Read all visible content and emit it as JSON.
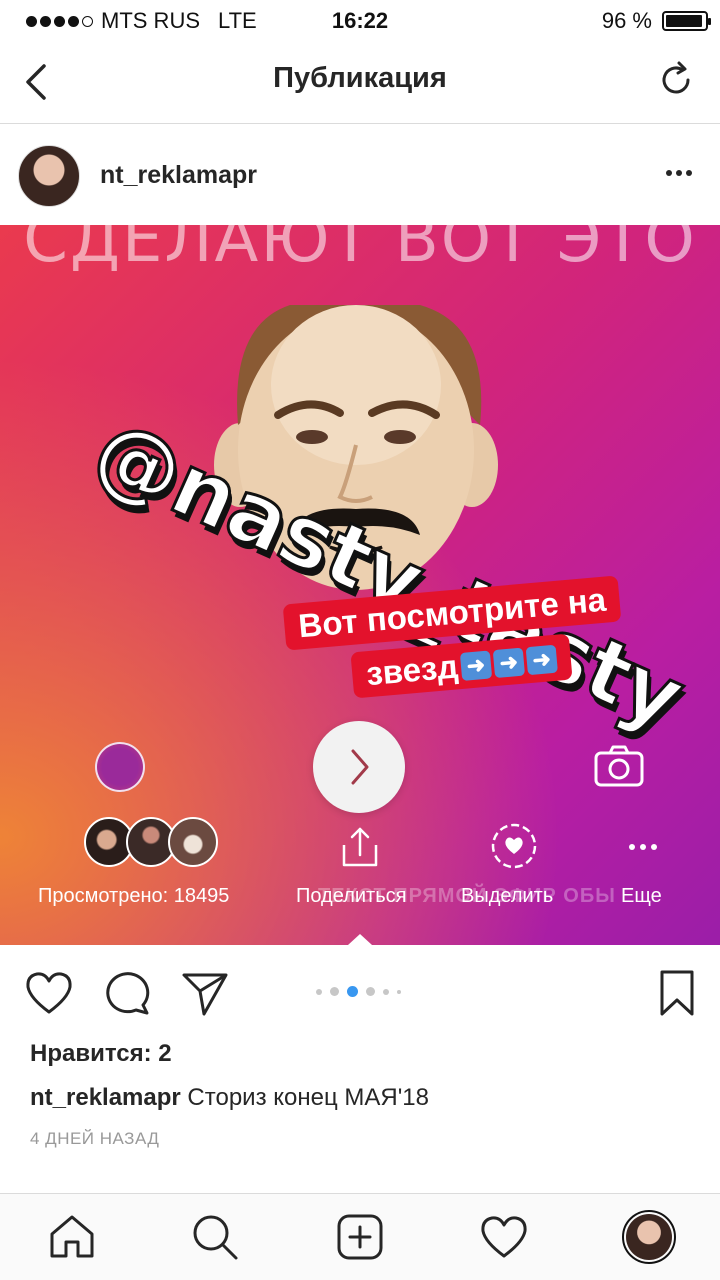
{
  "status_bar": {
    "carrier": "MTS RUS",
    "network": "LTE",
    "time": "16:22",
    "battery": "96 %",
    "battery_level": 0.96
  },
  "header": {
    "title": "Публикация",
    "icons": [
      "back-chevron-icon",
      "refresh-icon"
    ]
  },
  "post": {
    "username": "nt_reklamapr",
    "media": {
      "top_text": "СДЕЛАЮТ ВОТ ЭТО",
      "watermark": "@nasty_tasty",
      "sticker_line1": "Вот посмотрите на",
      "sticker_line2": "звезд",
      "ghost_text": "ТЕКСТ   ПРЯМОЙ ЭФИР   ОБЫ",
      "views_label": "Просмотрено: 18495",
      "share_label": "Поделиться",
      "highlight_label": "Выделить",
      "more_label": "Еще"
    },
    "carousel_index": 3,
    "likes": "Нравится: 2",
    "caption_user": "nt_reklamapr",
    "caption_text": "Сториз конец МАЯ'18",
    "date": "4 ДНЕЙ НАЗАД"
  },
  "colors": {
    "accent": "#3897f0",
    "sticker": "#e3122c",
    "divider": "#dbdbdb"
  },
  "tab_bar": {
    "icons": [
      "home-icon",
      "search-icon",
      "add-icon",
      "heart-icon",
      "profile-avatar"
    ]
  }
}
